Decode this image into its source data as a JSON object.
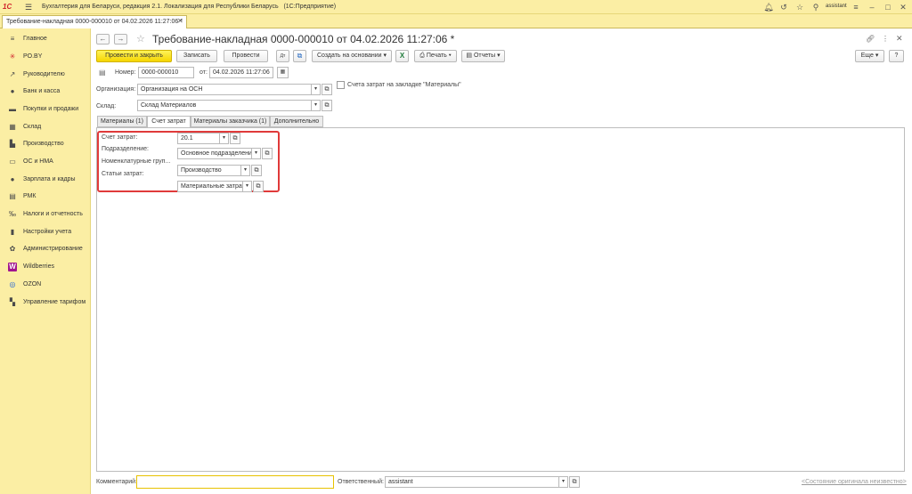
{
  "app": {
    "logo": "1С",
    "title": "Бухгалтерия для Беларуси, редакция 2.1. Локализация для Республики Беларусь",
    "platform": "(1С:Предприятие)",
    "username": "assistant"
  },
  "tabs": [
    {
      "label": "Требование-накладная 0000-000010 от 04.02.2026 11:27:06 *"
    }
  ],
  "sidebar": {
    "items": [
      {
        "label": "Главное",
        "icon": "≡"
      },
      {
        "label": "PO.BY",
        "icon": "✳"
      },
      {
        "label": "Руководителю",
        "icon": "↗"
      },
      {
        "label": "Банк и касса",
        "icon": "●"
      },
      {
        "label": "Покупки и продажи",
        "icon": "▬"
      },
      {
        "label": "Склад",
        "icon": "▦"
      },
      {
        "label": "Производство",
        "icon": "▙"
      },
      {
        "label": "ОС и НМА",
        "icon": "▭"
      },
      {
        "label": "Зарплата и кадры",
        "icon": "●"
      },
      {
        "label": "РМК",
        "icon": "▤"
      },
      {
        "label": "Налоги и отчетность",
        "icon": "‰"
      },
      {
        "label": "Настройки учета",
        "icon": "▮"
      },
      {
        "label": "Администрирование",
        "icon": "✿"
      },
      {
        "label": "Wildberries",
        "icon": "W"
      },
      {
        "label": "OZON",
        "icon": "◎"
      },
      {
        "label": "Управление тарифом",
        "icon": "▚"
      }
    ]
  },
  "document": {
    "title": "Требование-накладная 0000-000010 от 04.02.2026 11:27:06 *"
  },
  "toolbar": {
    "post_and_close": "Провести и закрыть",
    "save": "Записать",
    "post": "Провести",
    "create_based_on": "Создать на основании",
    "print": "Печать",
    "reports": "Отчеты",
    "more": "Еще",
    "help": "?"
  },
  "form": {
    "number_label": "Номер:",
    "number_value": "0000-000010",
    "date_label": "от:",
    "date_value": "04.02.2026 11:27:06",
    "org_label": "Организация:",
    "org_value": "Организация на ОСН",
    "warehouse_label": "Склад:",
    "warehouse_value": "Склад Материалов",
    "cost_account_checkbox_label": "Счета затрат на закладке \"Материалы\""
  },
  "form_tabs": [
    {
      "label": "Материалы (1)"
    },
    {
      "label": "Счет затрат"
    },
    {
      "label": "Материалы заказчика (1)"
    },
    {
      "label": "Дополнительно"
    }
  ],
  "cost_tab": {
    "account_label": "Счет затрат:",
    "account_value": "20.1",
    "department_label": "Подразделение:",
    "department_value": "Основное подразделение",
    "nomgroup_label": "Номенклатурные груп...",
    "nomgroup_value": "Производство",
    "costitem_label": "Статьи затрат:",
    "costitem_value": "Материальные затраты"
  },
  "footer": {
    "comment_label": "Комментарий:",
    "comment_value": "",
    "responsible_label": "Ответственный:",
    "responsible_value": "assistant",
    "original_status_link": "<Состояние оригинала неизвестно>"
  },
  "colors": {
    "accent_yellow": "#fbeea4",
    "primary_button": "#f5d500",
    "highlight_red": "#e03a3a"
  }
}
